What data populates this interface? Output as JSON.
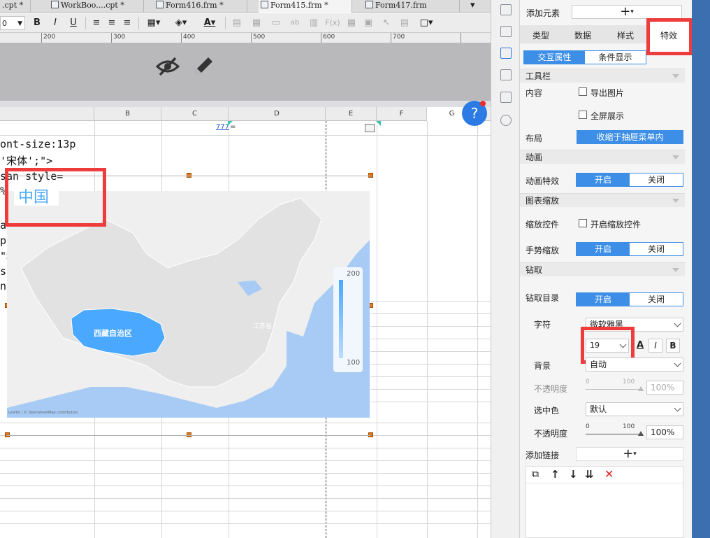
{
  "tabs": [
    {
      "label": ".cpt *"
    },
    {
      "label": "WorkBoo....cpt *"
    },
    {
      "label": "Form416.frm *"
    },
    {
      "label": "Form415.frm *"
    },
    {
      "label": "Form417.frm"
    }
  ],
  "toolbar": {
    "font_size": "0",
    "bold": "B",
    "italic": "I",
    "underline": "U"
  },
  "ruler": {
    "ticks": [
      "200",
      "300",
      "400",
      "500",
      "600",
      "700"
    ]
  },
  "columns": [
    "B",
    "C",
    "D",
    "E",
    "F",
    "G"
  ],
  "code_lines": [
    "ont-size:13p",
    "'宋体';\">",
    "san style=",
    "%   pt",
    "",
    "an",
    "p:",
    "\">",
    "s",
    "n'"
  ],
  "cell_value": "777",
  "cell_suffix": "=",
  "map": {
    "title": "中国",
    "region_label": "西藏自治区",
    "small_label": "江苏省",
    "legend_max": "200",
    "legend_min": "100",
    "attribution": "Leaflet | © OpenStreetMap contributors"
  },
  "help_button": "?",
  "panel": {
    "add_element_label": "添加元素",
    "add_symbol": "+",
    "tabs": [
      "类型",
      "数据",
      "样式",
      "特效"
    ],
    "subtabs": [
      "交互属性",
      "条件显示"
    ],
    "toolbar_section": "工具栏",
    "content_label": "内容",
    "export_image": "导出图片",
    "fullscreen": "全屏展示",
    "layout_label": "布局",
    "layout_value": "收缩于抽屉菜单内",
    "anim_section": "动画",
    "anim_effect_label": "动画特效",
    "on": "开启",
    "off": "关闭",
    "zoom_section": "图表缩放",
    "zoom_ctrl_label": "缩放控件",
    "zoom_ctrl_check": "开启缩放控件",
    "gesture_label": "手势缩放",
    "drill_section": "钻取",
    "drill_dir_label": "钻取目录",
    "font_label": "字符",
    "font_value": "微软雅黑",
    "size_value": "19",
    "style_a": "A",
    "style_i": "I",
    "style_b": "B",
    "bg_label": "背景",
    "bg_value": "自动",
    "opacity_label": "不透明度",
    "slider_min": "0",
    "slider_max": "100",
    "opacity1": "100%",
    "select_color_label": "选中色",
    "select_color_value": "默认",
    "opacity2": "100%",
    "add_link_label": "添加链接"
  },
  "colors": {
    "accent": "#3c8ee6",
    "map_highlight": "#4aa8ff",
    "ocean": "#a7cbf5",
    "annotation": "#ee3b3b"
  }
}
